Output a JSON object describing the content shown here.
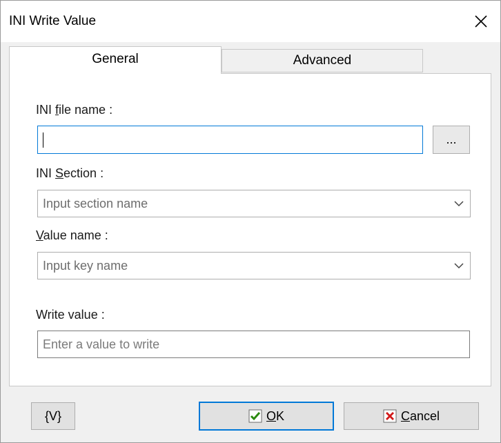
{
  "window": {
    "title": "INI Write Value"
  },
  "tabs": [
    {
      "label": "General",
      "active": true
    },
    {
      "label": "Advanced",
      "active": false
    }
  ],
  "form": {
    "ini_file_label_prefix": "INI ",
    "ini_file_label_accel": "f",
    "ini_file_label_suffix": "ile name :",
    "ini_file_value": "",
    "browse_label": "...",
    "section_label_prefix": "INI ",
    "section_label_accel": "S",
    "section_label_suffix": "ection :",
    "section_placeholder": "Input section name",
    "value_label_accel": "V",
    "value_label_suffix": "alue name :",
    "value_placeholder": "Input key name",
    "write_label": "Write value :",
    "write_placeholder": "Enter a value to write"
  },
  "footer": {
    "variable_label": "{V}",
    "ok_accel": "O",
    "ok_suffix": "K",
    "cancel_accel": "C",
    "cancel_suffix": "ancel"
  },
  "colors": {
    "accent": "#0078d7",
    "ok_check": "#2b8a0f",
    "cancel_x": "#d11a1a"
  },
  "icons": {
    "close": "close-icon",
    "dropdown": "chevron-down-icon",
    "ok": "checkmark-icon",
    "cancel": "x-icon"
  }
}
